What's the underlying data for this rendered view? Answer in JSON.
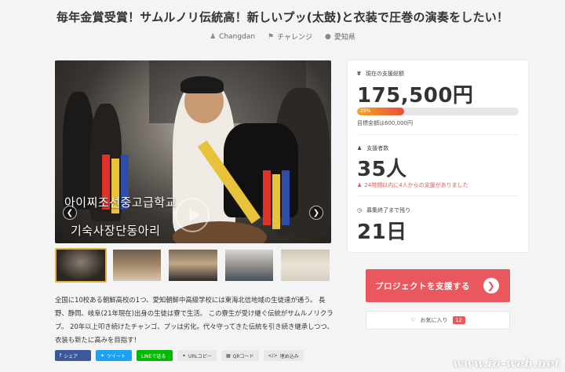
{
  "project": {
    "title": "毎年金賞受賞！サムルノリ伝統高！新しいプッ(太鼓)と衣装で圧巻の演奏をしたい！",
    "owner": "Changdan",
    "category": "チャレンジ",
    "location": "愛知県"
  },
  "icons": {
    "owner": "user-icon",
    "category": "tag-icon",
    "location": "pin-icon",
    "money": "yen-icon",
    "supporters": "users-icon",
    "alert": "users-icon",
    "time": "clock-icon",
    "heart": "heart-icon",
    "arrow": "chevron-right-icon"
  },
  "hero": {
    "caption_line1": "아이찌조선중고급학교",
    "caption_line2": "기숙사장단동아리"
  },
  "stats": {
    "amount_label": "現在の支援総額",
    "amount": "175,500円",
    "progress_percent": 29,
    "progress_label": "29%",
    "goal_text": "目標金額は600,000円",
    "supporters_label": "支援者数",
    "supporters": "35人",
    "recent_text": "24時間以内に4人からの支援がありました",
    "days_label": "募集終了まで残り",
    "days": "21日"
  },
  "actions": {
    "support_label": "プロジェクトを支援する",
    "favorite_label": "お気に入り",
    "favorite_count": "12"
  },
  "description": "全国に10校ある朝鮮高校の1つ、愛知朝鮮中高級学校には東海北信地域の生徒達が通う。 長野、静岡、岐阜(21年現在)出身の生徒は寮で生活。 この寮生が受け継ぐ伝統がサムルノリクラブ。 20年以上叩き続けたチャンゴ、プッは劣化。代々守ってきた伝統を引き続き継承しつつ、衣装も新たに高みを目指す！",
  "share": {
    "facebook": "シェア",
    "twitter": "ツイート",
    "line": "LINEで送る",
    "url": "URLコピー",
    "qr": "QRコード",
    "embed": "埋め込み"
  },
  "watermark": "www.io-web.net"
}
